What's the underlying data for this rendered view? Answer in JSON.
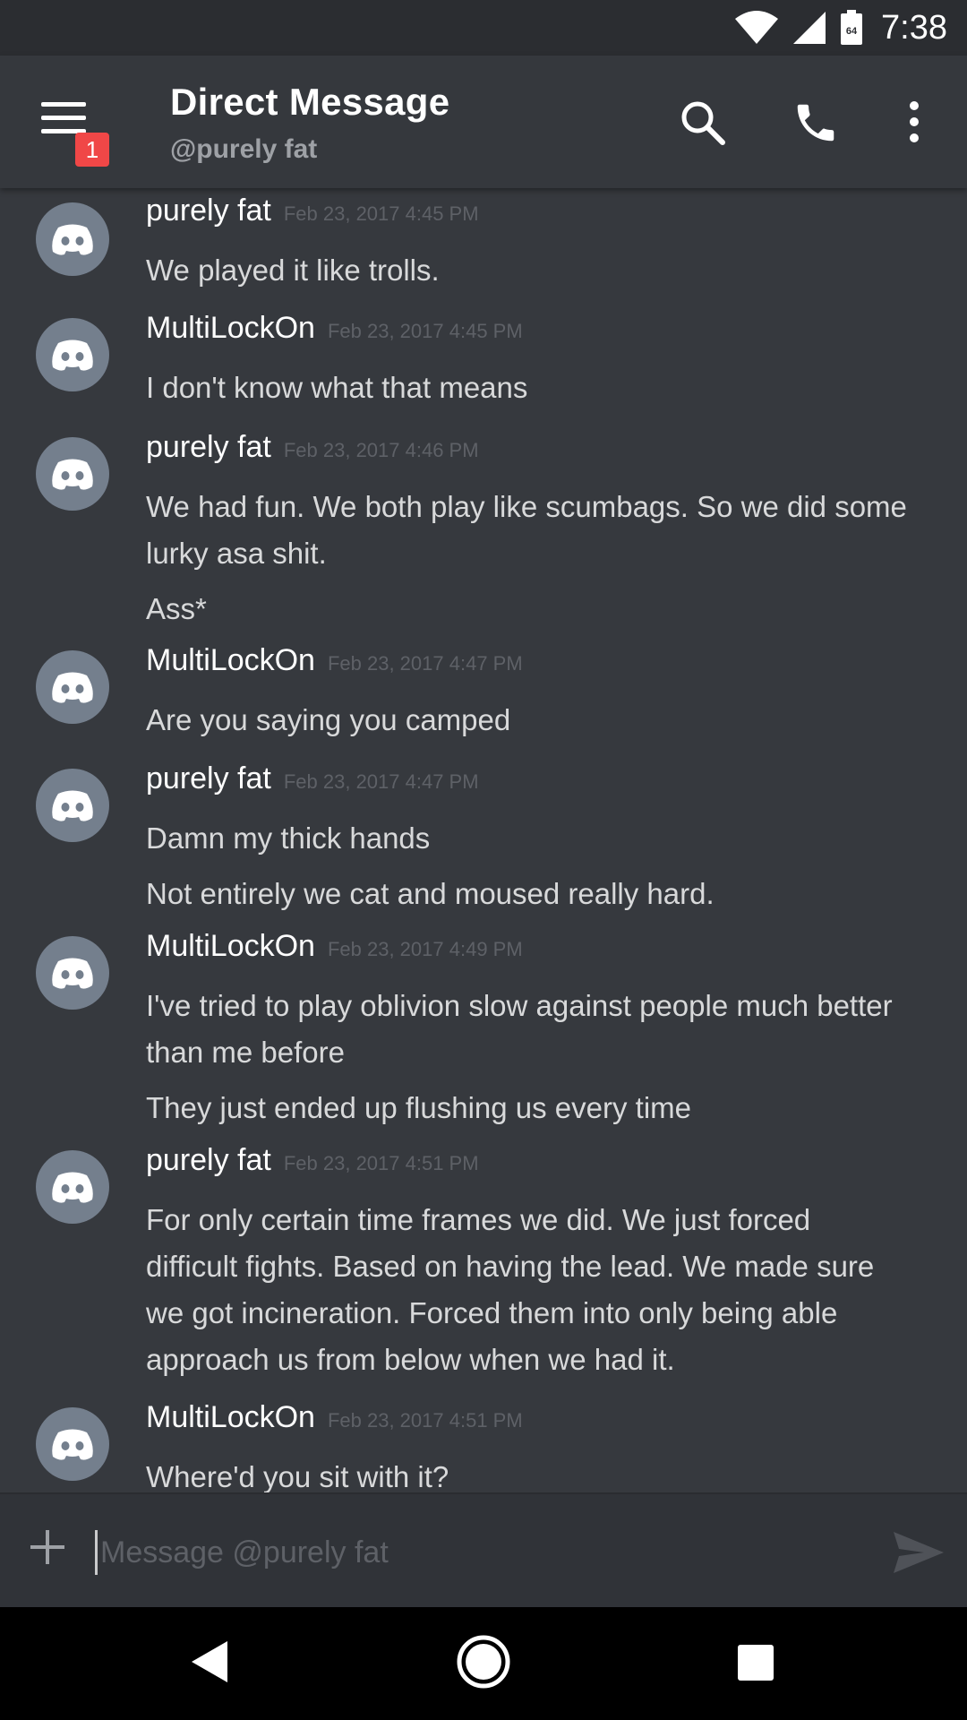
{
  "status_bar": {
    "time": "7:38",
    "battery_level": "64"
  },
  "header": {
    "title": "Direct Message",
    "subtitle": "@purely fat",
    "notification_count": "1",
    "icons": [
      "menu-icon",
      "search-icon",
      "phone-icon",
      "more-vert-icon"
    ]
  },
  "messages": [
    {
      "author": "purely fat",
      "timestamp": "Feb 23, 2017 4:45 PM",
      "lines": [
        "We played it like trolls."
      ]
    },
    {
      "author": "MultiLockOn",
      "timestamp": "Feb 23, 2017 4:45 PM",
      "lines": [
        "I don't know what that means"
      ]
    },
    {
      "author": "purely fat",
      "timestamp": "Feb 23, 2017 4:46 PM",
      "lines": [
        "We had fun. We both play like scumbags. So we did some",
        "lurky asa shit.",
        "Ass*"
      ]
    },
    {
      "author": "MultiLockOn",
      "timestamp": "Feb 23, 2017 4:47 PM",
      "lines": [
        "Are you saying you camped"
      ]
    },
    {
      "author": "purely fat",
      "timestamp": "Feb 23, 2017 4:47 PM",
      "lines": [
        "Damn my thick hands",
        "Not entirely we cat and moused really hard."
      ]
    },
    {
      "author": "MultiLockOn",
      "timestamp": "Feb 23, 2017 4:49 PM",
      "lines": [
        "I've tried to play oblivion slow against people much better",
        "than me before",
        "They just ended up flushing us every time"
      ]
    },
    {
      "author": "purely fat",
      "timestamp": "Feb 23, 2017 4:51 PM",
      "lines": [
        "For only certain time frames we did. We just forced",
        "difficult fights. Based on having the lead. We made sure",
        "we got incineration. Forced them into only being able",
        "approach us from below when we had it."
      ]
    },
    {
      "author": "MultiLockOn",
      "timestamp": "Feb 23, 2017 4:51 PM",
      "lines": [
        "Where'd you sit with it?"
      ]
    }
  ],
  "composer": {
    "placeholder": "Message @purely fat"
  },
  "colors": {
    "background": "#36393e",
    "header": "#35383d",
    "avatar": "#747f8d",
    "badge": "#f04747",
    "timestamp": "#5e6167"
  }
}
